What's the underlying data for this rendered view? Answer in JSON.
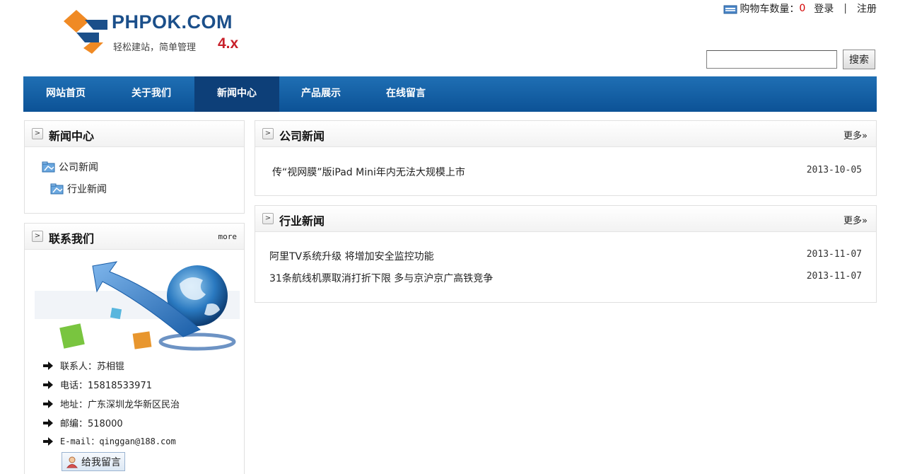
{
  "header": {
    "logo": {
      "name": "PHPOK.COM",
      "slogan": "轻松建站，简单管理",
      "version": "4.x"
    },
    "topbar": {
      "cart_label": "购物车数量：",
      "cart_count": "0",
      "login": "登录",
      "separator": "|",
      "register": "注册"
    },
    "search": {
      "value": "",
      "button_label": "搜索"
    }
  },
  "nav": {
    "items": [
      {
        "label": "网站首页",
        "active": false
      },
      {
        "label": "关于我们",
        "active": false
      },
      {
        "label": "新闻中心",
        "active": true
      },
      {
        "label": "产品展示",
        "active": false
      },
      {
        "label": "在线留言",
        "active": false
      }
    ]
  },
  "sidebar": {
    "news_center": {
      "title": "新闻中心",
      "categories": [
        {
          "label": "公司新闻"
        },
        {
          "label": "行业新闻"
        }
      ]
    },
    "contact": {
      "title": "联系我们",
      "more": "more",
      "lines": [
        "联系人：苏相锟",
        "电话：15818533971",
        "地址：广东深圳龙华新区民治",
        "邮编：518000",
        "E-mail：qinggan@188.com"
      ],
      "message_button": "给我留言"
    }
  },
  "main": {
    "company_news": {
      "title": "公司新闻",
      "more": "更多»",
      "items": [
        {
          "title": "传“视网膜”版iPad Mini年内无法大规模上市",
          "date": "2013-10-05"
        }
      ]
    },
    "industry_news": {
      "title": "行业新闻",
      "more": "更多»",
      "items": [
        {
          "title": "阿里TV系统升级 将增加安全监控功能",
          "date": "2013-11-07"
        },
        {
          "title": "31条航线机票取消打折下限 多与京沪京广高铁竞争",
          "date": "2013-11-07"
        }
      ]
    }
  },
  "colors": {
    "nav_blue": "#1566ad",
    "nav_active": "#0d3f78",
    "cart_count": "#d40000",
    "logo_blue": "#1b4f8a",
    "logo_orange": "#f08a24",
    "version_red": "#c8202a"
  }
}
